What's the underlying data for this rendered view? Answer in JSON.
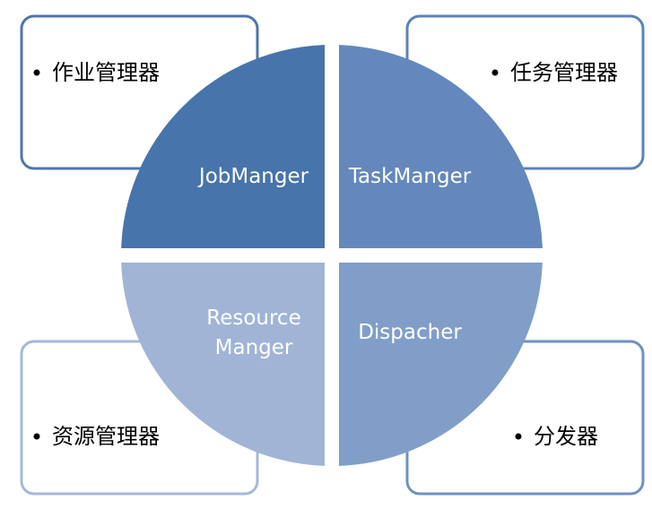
{
  "colors": {
    "top_left": "#4774ab",
    "top_right": "#6488bc",
    "bottom_left": "#a1b4d6",
    "bottom_right": "#819ec9",
    "box_border_dark": "#4f75ad",
    "box_border_light": "#9db4d8",
    "separator": "#ffffff"
  },
  "quadrants": {
    "top_left": {
      "label": "JobManger"
    },
    "top_right": {
      "label": "TaskManger"
    },
    "bottom_left": {
      "label_line1": "Resource",
      "label_line2": "Manger"
    },
    "bottom_right": {
      "label": "Dispacher"
    }
  },
  "boxes": {
    "top_left": {
      "text": "作业管理器"
    },
    "top_right": {
      "text": "任务管理器"
    },
    "bottom_left": {
      "text": "资源管理器"
    },
    "bottom_right": {
      "text": "分发器"
    }
  }
}
